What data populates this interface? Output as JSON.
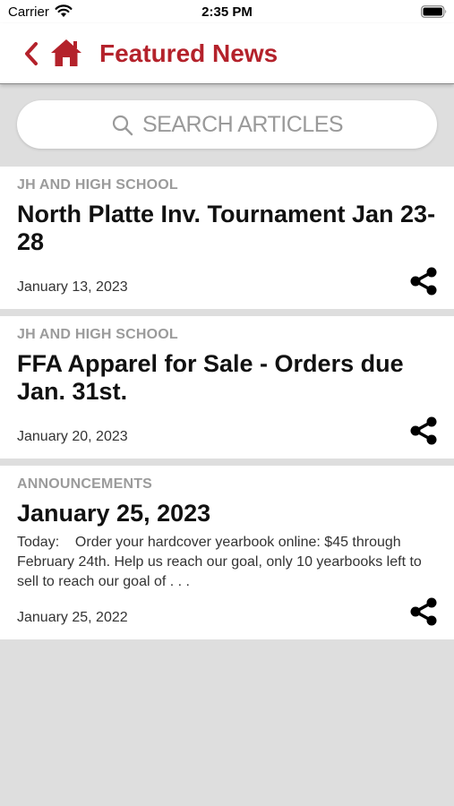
{
  "status_bar": {
    "carrier": "Carrier",
    "time": "2:35 PM"
  },
  "nav": {
    "title": "Featured News",
    "accent_color": "#b4222b",
    "icons": [
      "back-chevron",
      "home"
    ]
  },
  "search": {
    "placeholder": "SEARCH ARTICLES"
  },
  "articles": [
    {
      "category": "JH AND HIGH SCHOOL",
      "title": "North Platte Inv. Tournament Jan 23-28",
      "excerpt": "",
      "date": "January 13, 2023"
    },
    {
      "category": "JH AND HIGH SCHOOL",
      "title": "FFA Apparel for Sale - Orders due Jan. 31st.",
      "excerpt": "",
      "date": "January 20, 2023"
    },
    {
      "category": "ANNOUNCEMENTS",
      "title": "January 25, 2023",
      "excerpt": "Today:    Order your hardcover yearbook online: $45 through February 24th. Help us reach our goal, only 10 yearbooks left to sell to reach our goal of . . .",
      "date": "January 25, 2022"
    }
  ]
}
